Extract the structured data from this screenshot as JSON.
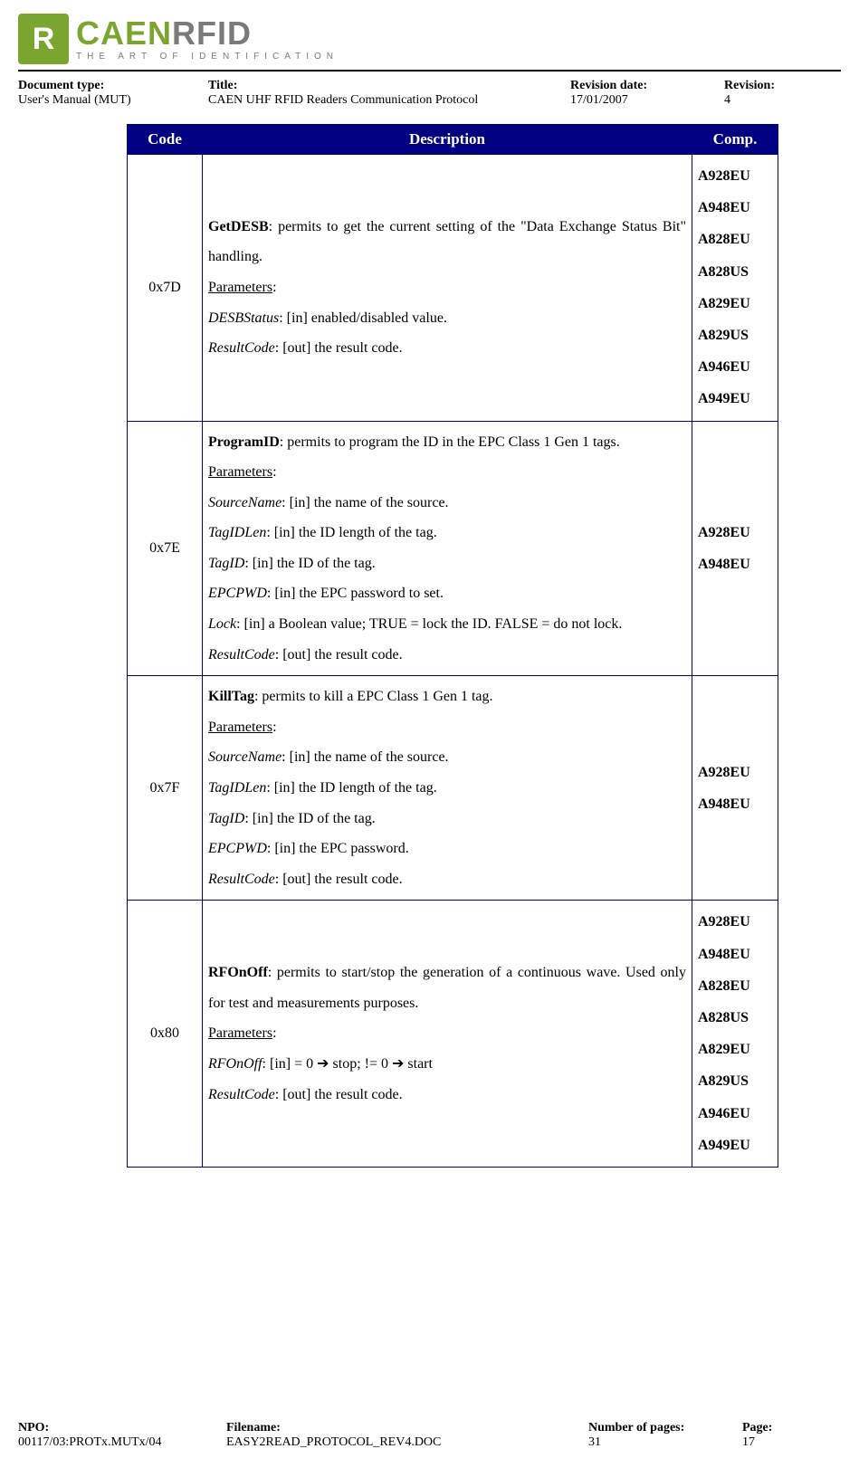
{
  "logo": {
    "brand_green": "CAEN",
    "brand_gray": "RFID",
    "tagline": "THE ART OF IDENTIFICATION"
  },
  "header": {
    "doc_type_lbl": "Document type:",
    "doc_type_val": "User's Manual (MUT)",
    "title_lbl": "Title:",
    "title_val": "CAEN UHF RFID Readers Communication Protocol",
    "revdate_lbl": "Revision date:",
    "revdate_val": "17/01/2007",
    "rev_lbl": "Revision:",
    "rev_val": "4"
  },
  "table": {
    "h_code": "Code",
    "h_desc": "Description",
    "h_comp": "Comp.",
    "rows": [
      {
        "code": "0x7D",
        "title": "GetDESB",
        "desc_after_title": ": permits to get the current setting of the \"Data Exchange Status Bit\" handling.",
        "params_label": "Parameters",
        "params": [
          {
            "name": "DESBStatus",
            "text": ": [in] enabled/disabled value."
          },
          {
            "name": "ResultCode",
            "text": ": [out] the result code."
          }
        ],
        "comp": [
          "A928EU",
          "A948EU",
          "A828EU",
          "A828US",
          "A829EU",
          "A829US",
          "A946EU",
          "A949EU"
        ]
      },
      {
        "code": "0x7E",
        "title": "ProgramID",
        "desc_after_title": ": permits to program the ID in the EPC Class 1 Gen 1 tags.",
        "params_label": "Parameters",
        "params": [
          {
            "name": "SourceName",
            "text": ": [in] the name of the source."
          },
          {
            "name": "TagIDLen",
            "text": ": [in] the ID length of the tag."
          },
          {
            "name": "TagID",
            "text": ": [in] the ID of the tag."
          },
          {
            "name": "EPCPWD",
            "text": ": [in] the EPC password to set."
          },
          {
            "name": "Lock",
            "text": ": [in] a Boolean value; TRUE = lock the ID. FALSE = do not lock."
          },
          {
            "name": "ResultCode",
            "text": ": [out] the result code."
          }
        ],
        "comp": [
          "A928EU",
          "A948EU"
        ]
      },
      {
        "code": "0x7F",
        "title": "KillTag",
        "desc_after_title": ": permits to kill a EPC Class 1 Gen 1 tag.",
        "params_label": "Parameters",
        "params": [
          {
            "name": "SourceName",
            "text": ": [in] the name of the source."
          },
          {
            "name": "TagIDLen",
            "text": ": [in] the ID length of the tag."
          },
          {
            "name": "TagID",
            "text": ": [in] the ID of the tag."
          },
          {
            "name": "EPCPWD",
            "text": ": [in] the EPC password."
          },
          {
            "name": "ResultCode",
            "text": ": [out] the result code."
          }
        ],
        "comp": [
          "A928EU",
          "A948EU"
        ]
      },
      {
        "code": "0x80",
        "title": "RFOnOff",
        "desc_after_title": ": permits to start/stop the generation of a continuous wave. Used only for test and measurements purposes.",
        "params_label": "Parameters",
        "params": [
          {
            "name": "RFOnOff",
            "text": ": [in] = 0 ➔ stop; != 0 ➔ start"
          },
          {
            "name": "ResultCode",
            "text": ": [out] the result code."
          }
        ],
        "comp": [
          "A928EU",
          "A948EU",
          "A828EU",
          "A828US",
          "A829EU",
          "A829US",
          "A946EU",
          "A949EU"
        ]
      }
    ]
  },
  "footer": {
    "npo_lbl": "NPO:",
    "npo_val": "00117/03:PROTx.MUTx/04",
    "file_lbl": "Filename:",
    "file_val": "EASY2READ_PROTOCOL_REV4.DOC",
    "numpg_lbl": "Number of pages:",
    "numpg_val": "31",
    "page_lbl": "Page:",
    "page_val": "17"
  }
}
